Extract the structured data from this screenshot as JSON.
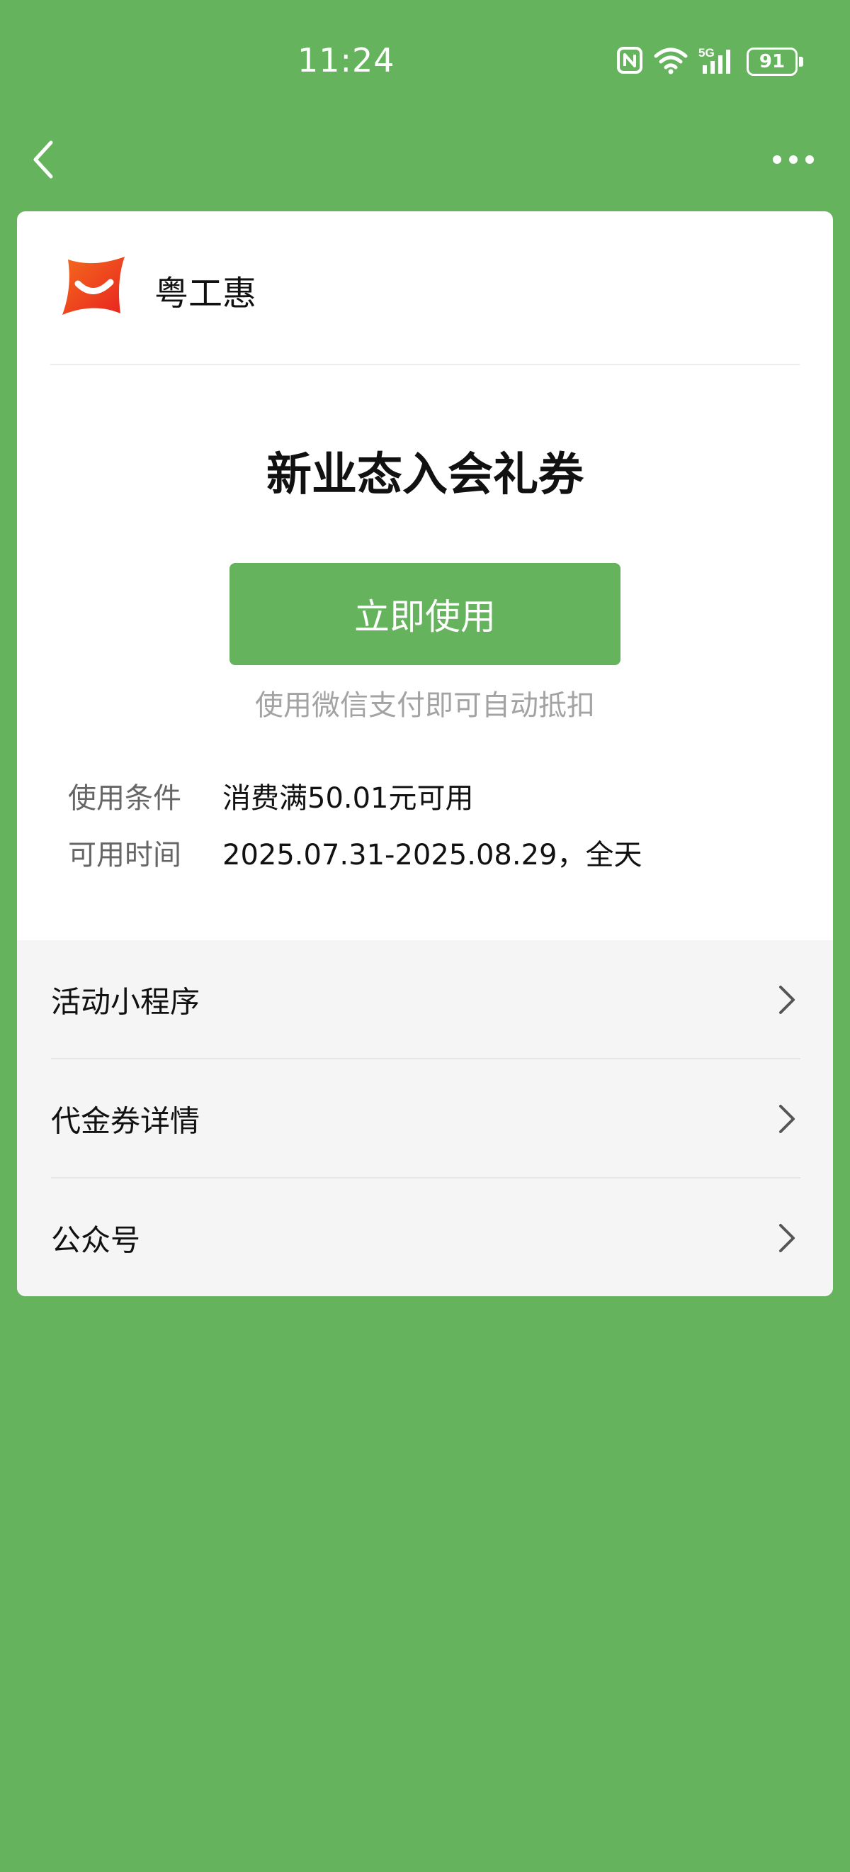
{
  "status_bar": {
    "time": "11:24",
    "battery_level": "91",
    "network": "5G",
    "icons": [
      "nfc-icon",
      "wifi-icon",
      "signal-5g-icon",
      "battery-icon"
    ]
  },
  "nav": {
    "back_icon": "chevron-left-icon",
    "more_icon": "more-dots-icon"
  },
  "brand": {
    "name": "粤工惠",
    "logo_icon": "brand-logo-icon"
  },
  "coupon": {
    "title": "新业态入会礼券",
    "use_button_label": "立即使用",
    "hint": "使用微信支付即可自动抵扣",
    "conditions_label": "使用条件",
    "conditions_value": "消费满50.01元可用",
    "period_label": "可用时间",
    "period_value": "2025.07.31-2025.08.29，全天"
  },
  "links": [
    {
      "label": "活动小程序"
    },
    {
      "label": "代金券详情"
    },
    {
      "label": "公众号"
    }
  ],
  "colors": {
    "accent": "#66b35d",
    "card_background": "#ffffff",
    "links_background": "#f5f5f5",
    "brand_logo_red": "#ef3a2a",
    "brand_logo_orange": "#f46b1e"
  }
}
